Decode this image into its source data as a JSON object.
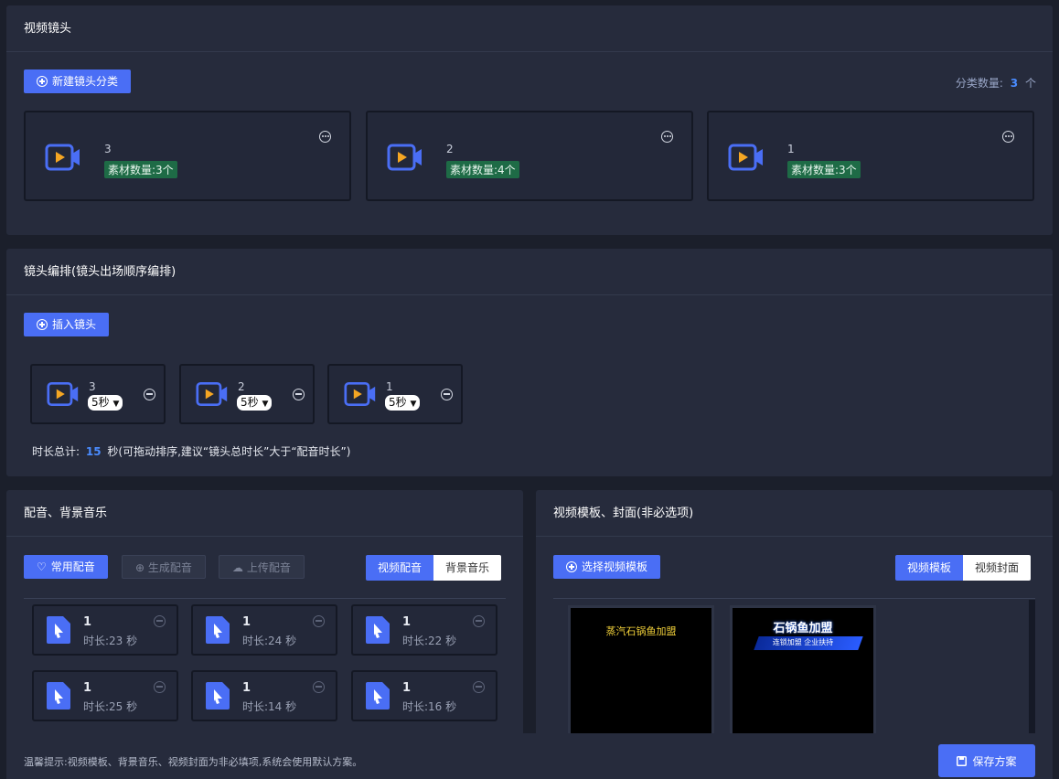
{
  "shots_panel": {
    "title": "视频镜头",
    "new_category_label": "新建镜头分类",
    "count_label": "分类数量:",
    "count_value": "3",
    "count_unit": "个",
    "categories": [
      {
        "name": "3",
        "tag": "素材数量:3个"
      },
      {
        "name": "2",
        "tag": "素材数量:4个"
      },
      {
        "name": "1",
        "tag": "素材数量:3个"
      }
    ]
  },
  "arrange_panel": {
    "title": "镜头编排(镜头出场顺序编排)",
    "insert_label": "插入镜头",
    "shots": [
      {
        "name": "3",
        "duration": "5秒"
      },
      {
        "name": "2",
        "duration": "5秒"
      },
      {
        "name": "1",
        "duration": "5秒"
      }
    ],
    "total_label": "时长总计:",
    "total_value": "15",
    "total_suffix": "秒(可拖动排序,建议“镜头总时长”大于“配音时长”)"
  },
  "audio_panel": {
    "title": "配音、背景音乐",
    "common_label": "常用配音",
    "generate_label": "生成配音",
    "upload_label": "上传配音",
    "tab_voice": "视频配音",
    "tab_music": "背景音乐",
    "items": [
      {
        "name": "1",
        "duration": "时长:23 秒"
      },
      {
        "name": "1",
        "duration": "时长:24 秒"
      },
      {
        "name": "1",
        "duration": "时长:22 秒"
      },
      {
        "name": "1",
        "duration": "时长:25 秒"
      },
      {
        "name": "1",
        "duration": "时长:14 秒"
      },
      {
        "name": "1",
        "duration": "时长:16 秒"
      }
    ]
  },
  "template_panel": {
    "title": "视频模板、封面(非必选项)",
    "select_label": "选择视频模板",
    "tab_template": "视频模板",
    "tab_cover": "视频封面",
    "templates": [
      {
        "caption": "蒸汽石锅鱼加盟"
      },
      {
        "caption": "石锅鱼加盟",
        "subcaption": "连锁加盟 企业扶持"
      }
    ]
  },
  "footer": {
    "tip": "温馨提示:视频模板、背景音乐、视频封面为非必填项,系统会使用默认方案。",
    "save_label": "保存方案"
  },
  "colors": {
    "accent": "#4a6ef5",
    "tag_green": "#1e6b46",
    "camera_orange": "#f5a623",
    "audio_blue": "#4a6ef5"
  }
}
